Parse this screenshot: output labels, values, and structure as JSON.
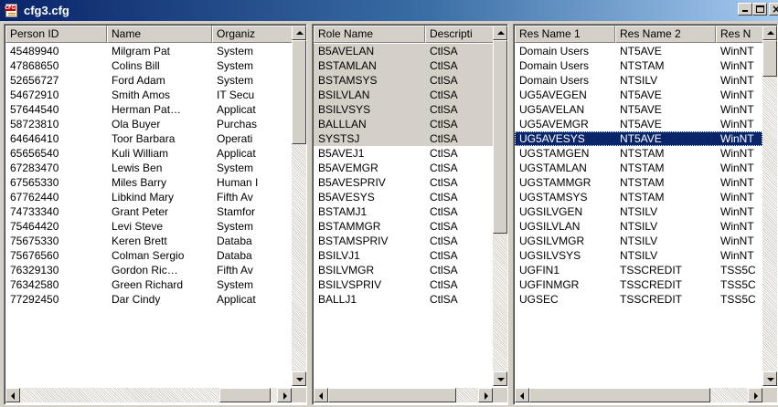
{
  "window": {
    "title": "cfg3.cfg",
    "icon": "cfg-file-icon"
  },
  "person_pane": {
    "headers": [
      "Person ID",
      "Name",
      "Organiz"
    ],
    "rows": [
      [
        "45489940",
        "Milgram Pat",
        "System"
      ],
      [
        "47868650",
        "Colins Bill",
        "System"
      ],
      [
        "52656727",
        "Ford Adam",
        "System"
      ],
      [
        "54672910",
        "Smith Amos",
        "IT Secu"
      ],
      [
        "57644540",
        "Herman Pat…",
        "Applicat"
      ],
      [
        "58723810",
        "Ola Buyer",
        "Purchas"
      ],
      [
        "64646410",
        "Toor Barbara",
        "Operati"
      ],
      [
        "65656540",
        "Kuli William",
        "Applicat"
      ],
      [
        "67283470",
        "Lewis Ben",
        "System"
      ],
      [
        "67565330",
        "Miles Barry",
        "Human I"
      ],
      [
        "67762440",
        "Libkind Mary",
        "Fifth Av"
      ],
      [
        "74733340",
        "Grant Peter",
        "Stamfor"
      ],
      [
        "75464420",
        "Levi Steve",
        "System"
      ],
      [
        "75675330",
        "Keren Brett",
        "Databa"
      ],
      [
        "75676560",
        "Colman Sergio",
        "Databa"
      ],
      [
        "76329130",
        "Gordon Ric…",
        "Fifth Av"
      ],
      [
        "76342580",
        "Green Richard",
        "System"
      ],
      [
        "77292450",
        "Dar Cindy",
        "Applicat"
      ]
    ]
  },
  "role_pane": {
    "headers": [
      "Role Name",
      "Descripti"
    ],
    "rows": [
      [
        "B5AVELAN",
        "CtlSA"
      ],
      [
        "BSTAMLAN",
        "CtlSA"
      ],
      [
        "BSTAMSYS",
        "CtlSA"
      ],
      [
        "BSILVLAN",
        "CtlSA"
      ],
      [
        "BSILVSYS",
        "CtlSA"
      ],
      [
        "BALLLAN",
        "CtlSA"
      ],
      [
        "SYSTSJ",
        "CtlSA"
      ],
      [
        "B5AVEJ1",
        "CtlSA"
      ],
      [
        "B5AVEMGR",
        "CtlSA"
      ],
      [
        "B5AVESPRIV",
        "CtlSA"
      ],
      [
        "B5AVESYS",
        "CtlSA"
      ],
      [
        "BSTAMJ1",
        "CtlSA"
      ],
      [
        "BSTAMMGR",
        "CtlSA"
      ],
      [
        "BSTAMSPRIV",
        "CtlSA"
      ],
      [
        "BSILVJ1",
        "CtlSA"
      ],
      [
        "BSILVMGR",
        "CtlSA"
      ],
      [
        "BSILVSPRIV",
        "CtlSA"
      ],
      [
        "BALLJ1",
        "CtlSA"
      ]
    ],
    "highlighted_rows": 7
  },
  "resource_pane": {
    "headers": [
      "Res Name 1",
      "Res Name 2",
      "Res N"
    ],
    "rows": [
      [
        "Domain Users",
        "NT5AVE",
        "WinNT"
      ],
      [
        "Domain Users",
        "NTSTAM",
        "WinNT"
      ],
      [
        "Domain Users",
        "NTSILV",
        "WinNT"
      ],
      [
        "UG5AVEGEN",
        "NT5AVE",
        "WinNT"
      ],
      [
        "UG5AVELAN",
        "NT5AVE",
        "WinNT"
      ],
      [
        "UG5AVEMGR",
        "NT5AVE",
        "WinNT"
      ],
      [
        "UG5AVESYS",
        "NT5AVE",
        "WinNT"
      ],
      [
        "UGSTAMGEN",
        "NTSTAM",
        "WinNT"
      ],
      [
        "UGSTAMLAN",
        "NTSTAM",
        "WinNT"
      ],
      [
        "UGSTAMMGR",
        "NTSTAM",
        "WinNT"
      ],
      [
        "UGSTAMSYS",
        "NTSTAM",
        "WinNT"
      ],
      [
        "UGSILVGEN",
        "NTSILV",
        "WinNT"
      ],
      [
        "UGSILVLAN",
        "NTSILV",
        "WinNT"
      ],
      [
        "UGSILVMGR",
        "NTSILV",
        "WinNT"
      ],
      [
        "UGSILVSYS",
        "NTSILV",
        "WinNT"
      ],
      [
        "UGFIN1",
        "TSSCREDIT",
        "TSS5C"
      ],
      [
        "UGFINMGR",
        "TSSCREDIT",
        "TSS5C"
      ],
      [
        "UGSEC",
        "TSSCREDIT",
        "TSS5C"
      ]
    ],
    "selected_row": 6
  },
  "colors": {
    "selection": "#0a246a",
    "highlight_gray": "#d4d0c8",
    "title_start": "#0a246a",
    "title_end": "#a6caf0"
  }
}
